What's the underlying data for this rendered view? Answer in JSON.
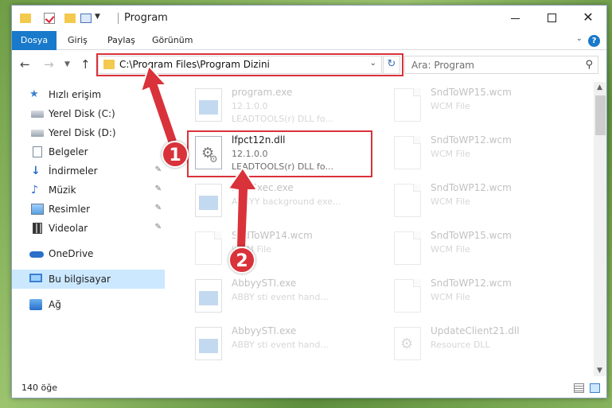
{
  "window": {
    "title": "Program",
    "controls": {
      "minimize": "—",
      "maximize": "☐",
      "close": "✕"
    }
  },
  "ribbon": {
    "tabs": [
      "Dosya",
      "Giriş",
      "Paylaş",
      "Görünüm"
    ],
    "help": "?"
  },
  "navigation": {
    "address": "C:\\Program Files\\Program Dizini",
    "search_placeholder": "Ara: Program"
  },
  "sidebar": {
    "items": [
      {
        "label": "Hızlı erişim",
        "icon": "star-icon",
        "pinned": false
      },
      {
        "label": "Yerel Disk (C:)",
        "icon": "drive-icon",
        "pinned": true
      },
      {
        "label": "Yerel Disk (D:)",
        "icon": "drive-icon",
        "pinned": false
      },
      {
        "label": "Belgeler",
        "icon": "documents-icon",
        "pinned": false
      },
      {
        "label": "İndirmeler",
        "icon": "downloads-icon",
        "pinned": true
      },
      {
        "label": "Müzik",
        "icon": "music-icon",
        "pinned": true
      },
      {
        "label": "Resimler",
        "icon": "pictures-icon",
        "pinned": true
      },
      {
        "label": "Videolar",
        "icon": "videos-icon",
        "pinned": true
      },
      {
        "label": "OneDrive",
        "icon": "onedrive-icon",
        "pinned": false
      },
      {
        "label": "Bu bilgisayar",
        "icon": "computer-icon",
        "pinned": false,
        "selected": true
      },
      {
        "label": "Ağ",
        "icon": "network-icon",
        "pinned": false
      }
    ]
  },
  "files": [
    {
      "name": "program.exe",
      "line1": "12.1.0.0",
      "line2": "LEADTOOLS(r) DLL fo...",
      "type": "exe",
      "faded": true
    },
    {
      "name": "SndToWP15.wcm",
      "line1": "WCM File",
      "line2": "",
      "type": "doc",
      "faded": true
    },
    {
      "name": "lfpct12n.dll",
      "line1": "12.1.0.0",
      "line2": "LEADTOOLS(r) DLL fo...",
      "type": "dll",
      "faded": false
    },
    {
      "name": "SndToWP12.wcm",
      "line1": "WCM File",
      "line2": "",
      "type": "doc",
      "faded": true
    },
    {
      "name": "FineExec.exe",
      "line1": "ABBYY background exe...",
      "line2": "",
      "type": "exe",
      "faded": true
    },
    {
      "name": "SndToWP12.wcm",
      "line1": "WCM File",
      "line2": "",
      "type": "doc",
      "faded": true
    },
    {
      "name": "SndToWP14.wcm",
      "line1": "WCM File",
      "line2": "",
      "type": "doc",
      "faded": true
    },
    {
      "name": "SndToWP15.wcm",
      "line1": "WCM File",
      "line2": "",
      "type": "doc",
      "faded": true
    },
    {
      "name": "AbbyySTI.exe",
      "line1": "ABBY sti event hand...",
      "line2": "",
      "type": "exe",
      "faded": true
    },
    {
      "name": "SndToWP12.wcm",
      "line1": "WCM File",
      "line2": "",
      "type": "doc",
      "faded": true
    },
    {
      "name": "AbbyySTI.exe",
      "line1": "ABBY sti event hand...",
      "line2": "",
      "type": "exe",
      "faded": true
    },
    {
      "name": "UpdateClient21.dll",
      "line1": "Resource DLL",
      "line2": "",
      "type": "dll",
      "faded": true
    }
  ],
  "status": {
    "count": "140 öğe"
  },
  "callouts": [
    "1",
    "2"
  ],
  "colors": {
    "accent": "#1979ca",
    "highlight": "#d9323a",
    "selected": "#cce8ff"
  }
}
